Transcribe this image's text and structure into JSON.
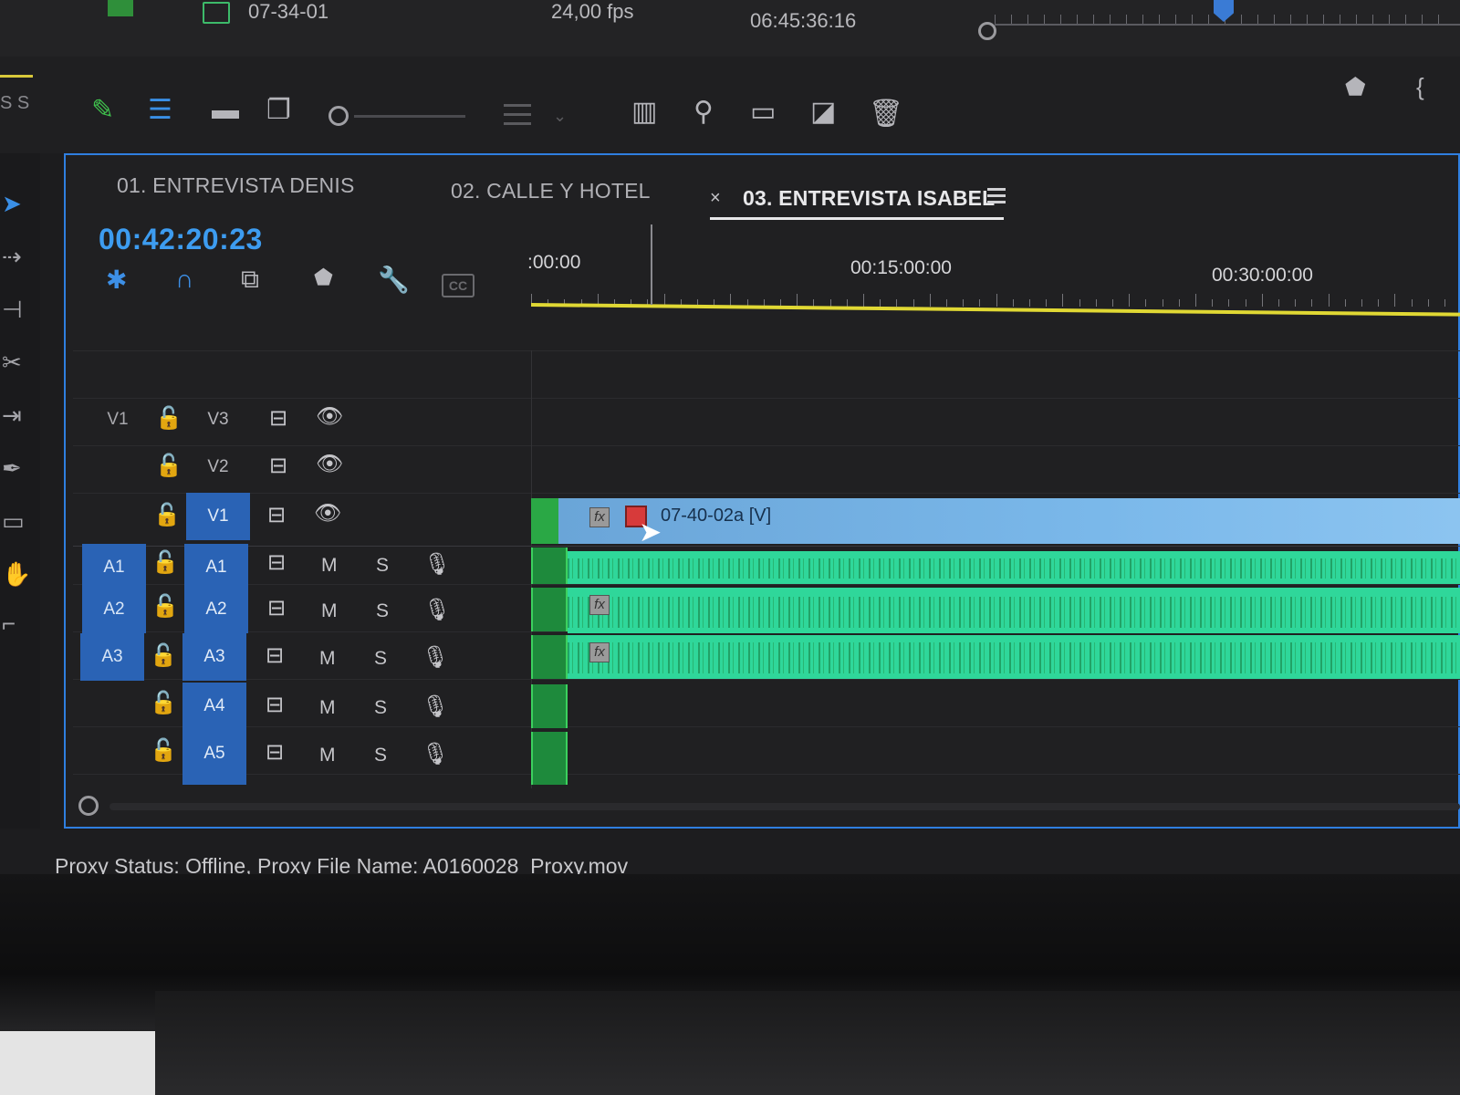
{
  "project": {
    "clip_name": "07-34-01",
    "fps": "24,00 fps",
    "duration": "06:45:36:16"
  },
  "colors": {
    "accent": "#2f7fe0",
    "timecode": "#3d9cf0",
    "video_clip": "#7ab8ea",
    "audio_clip": "#2fd79a",
    "work_area": "#e0d834",
    "track_target": "#2a63b5"
  },
  "sequence_tabs": [
    {
      "label": "01. ENTREVISTA DENIS"
    },
    {
      "label": "02. CALLE Y HOTEL"
    },
    {
      "label": "03. ENTREVISTA ISABEL"
    }
  ],
  "tab_close": "×",
  "timecode": "00:42:20:23",
  "cc_label": "CC",
  "ruler": {
    "labels": [
      ":00:00",
      "00:15:00:00",
      "00:30:00:00"
    ]
  },
  "video_tracks": [
    {
      "source": "V1",
      "target": "V3"
    },
    {
      "source": "",
      "target": "V2"
    },
    {
      "source": "",
      "target": "V1"
    }
  ],
  "audio_tracks": [
    {
      "source": "A1",
      "target": "A1"
    },
    {
      "source": "A2",
      "target": "A2"
    },
    {
      "source": "A3",
      "target": "A3"
    },
    {
      "source": "",
      "target": "A4"
    },
    {
      "source": "",
      "target": "A5"
    }
  ],
  "track_buttons": {
    "mute": "M",
    "solo": "S"
  },
  "clips": {
    "video": "07-40-02a [V]",
    "fx": "fx"
  },
  "status": "Proxy Status: Offline, Proxy File Name: A0160028_Proxy.mov",
  "top_left_label": "S S"
}
